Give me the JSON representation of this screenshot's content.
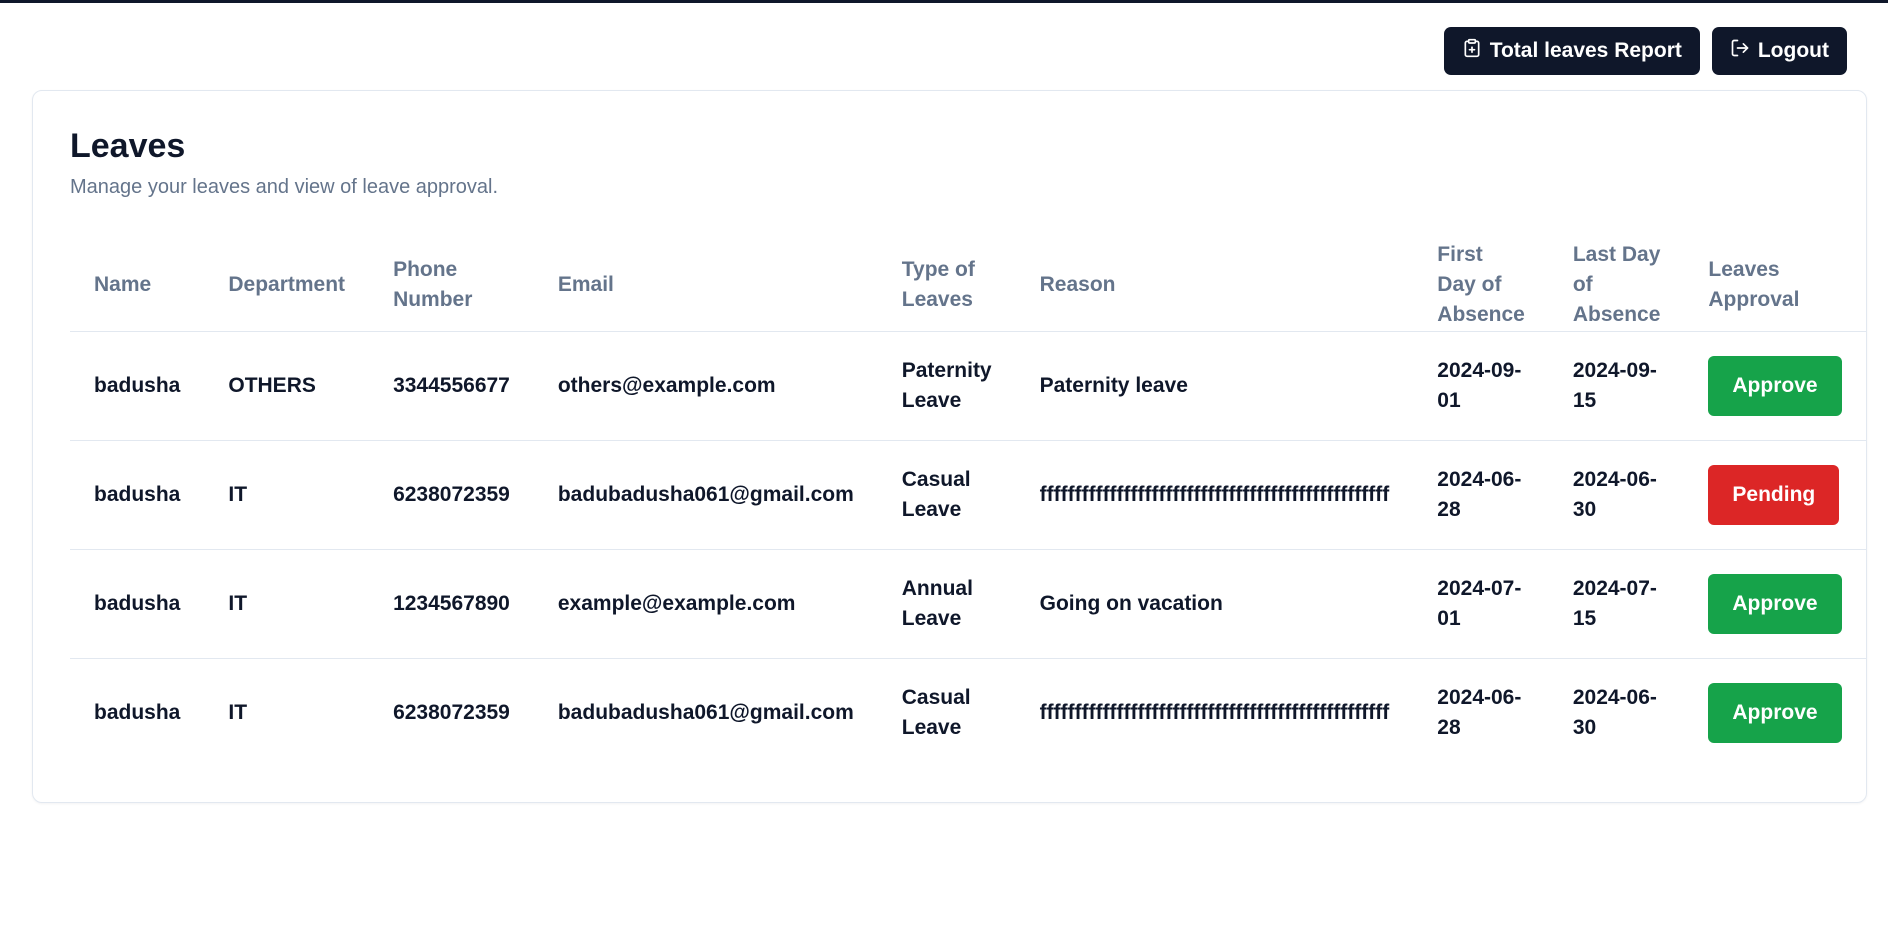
{
  "header": {
    "report_label": "Total leaves Report",
    "logout_label": "Logout"
  },
  "card": {
    "title": "Leaves",
    "subtitle": "Manage your leaves and view of leave approval."
  },
  "table": {
    "columns": [
      "Name",
      "Department",
      "Phone Number",
      "Email",
      "Type of Leaves",
      "Reason",
      "First Day of Absence",
      "Last Day of Absence",
      "Leaves Approval"
    ],
    "rows": [
      {
        "name": "badusha",
        "department": "OTHERS",
        "phone": "3344556677",
        "email": "others@example.com",
        "type": "Paternity Leave",
        "reason": "Paternity leave",
        "first_day": "2024-09-01",
        "last_day": "2024-09-15",
        "status": "Approve"
      },
      {
        "name": "badusha",
        "department": "IT",
        "phone": "6238072359",
        "email": "badubadusha061@gmail.com",
        "type": "Casual Leave",
        "reason": "ffffffffffffffffffffffffffffffffffffffffffffffffff",
        "first_day": "2024-06-28",
        "last_day": "2024-06-30",
        "status": "Pending"
      },
      {
        "name": "badusha",
        "department": "IT",
        "phone": "1234567890",
        "email": "example@example.com",
        "type": "Annual Leave",
        "reason": "Going on vacation",
        "first_day": "2024-07-01",
        "last_day": "2024-07-15",
        "status": "Approve"
      },
      {
        "name": "badusha",
        "department": "IT",
        "phone": "6238072359",
        "email": "badubadusha061@gmail.com",
        "type": "Casual Leave",
        "reason": "ffffffffffffffffffffffffffffffffffffffffffffffffff",
        "first_day": "2024-06-28",
        "last_day": "2024-06-30",
        "status": "Approve"
      }
    ]
  },
  "colors": {
    "dark": "#0f172a",
    "approve": "#16a34a",
    "pending": "#dc2626",
    "muted": "#64748b",
    "border": "#e2e8f0"
  },
  "icons": {
    "report": "clipboard-plus-icon",
    "logout": "logout-icon"
  }
}
